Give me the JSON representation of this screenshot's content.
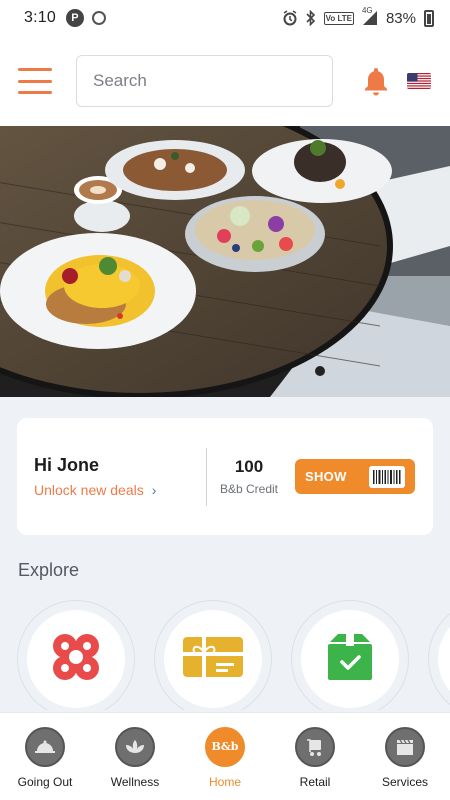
{
  "status_bar": {
    "time": "3:10",
    "app_badge": "P",
    "network": "4G",
    "volte": "Vo LTE",
    "battery": "83%"
  },
  "header": {
    "search_placeholder": "Search"
  },
  "greeting": {
    "title": "Hi Jone",
    "deal_link": "Unlock new deals",
    "credit_value": "100",
    "credit_label": "B&b Credit",
    "show_button": "SHOW"
  },
  "explore": {
    "title": "Explore",
    "items": [
      {
        "icon": "flower-icon",
        "color": "#e94b4b"
      },
      {
        "icon": "gift-card-icon",
        "color": "#e6b12d"
      },
      {
        "icon": "package-check-icon",
        "color": "#3cb44a"
      }
    ]
  },
  "bottom_nav": {
    "items": [
      {
        "label": "Going Out",
        "icon": "cloche-icon"
      },
      {
        "label": "Wellness",
        "icon": "lotus-icon"
      },
      {
        "label": "Home",
        "icon": "bb-logo-icon",
        "glyph": "B&b",
        "active": true
      },
      {
        "label": "Retail",
        "icon": "cart-icon"
      },
      {
        "label": "Services",
        "icon": "clapperboard-icon"
      }
    ]
  },
  "colors": {
    "accent": "#ee7b47",
    "button": "#ef8b2b",
    "background": "#eef1f6"
  }
}
